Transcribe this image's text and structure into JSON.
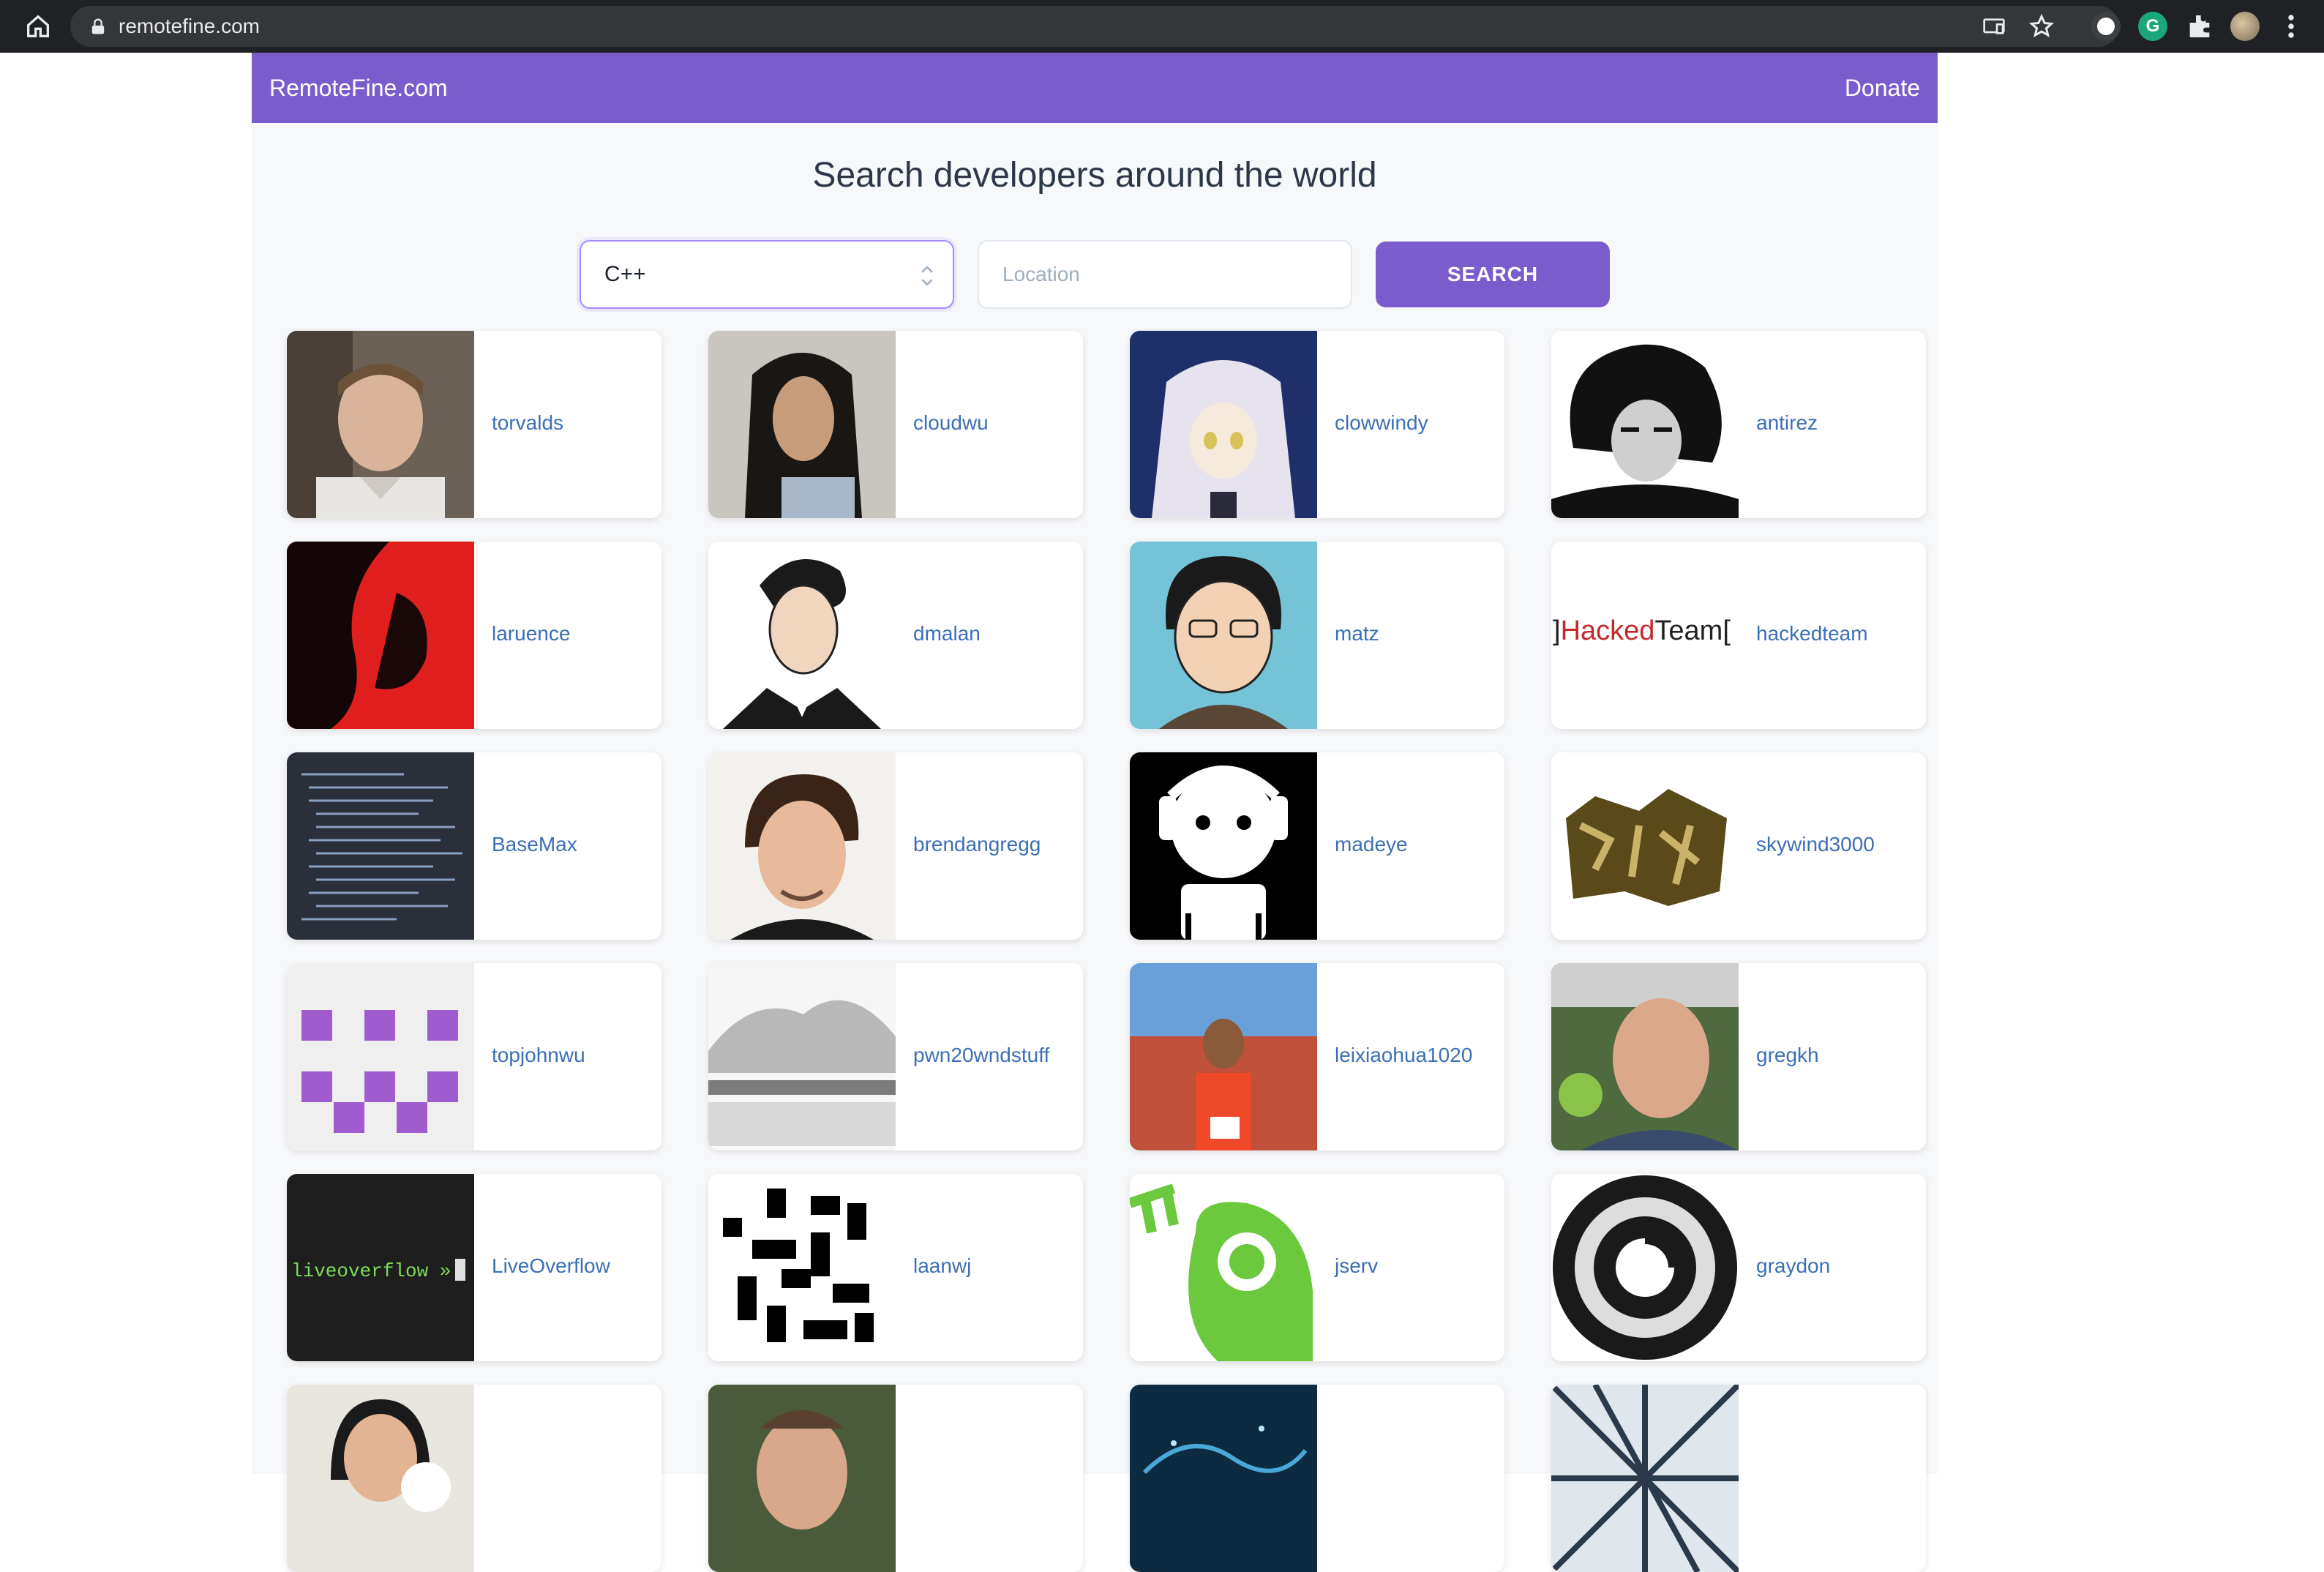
{
  "browser": {
    "url": "remotefine.com"
  },
  "navbar": {
    "brand": "RemoteFine.com",
    "donate": "Donate"
  },
  "headline": "Search developers around the world",
  "search": {
    "language": "C++",
    "location_placeholder": "Location",
    "button": "SEARCH"
  },
  "developers": [
    {
      "name": "torvalds"
    },
    {
      "name": "cloudwu"
    },
    {
      "name": "clowwindy"
    },
    {
      "name": "antirez"
    },
    {
      "name": "laruence"
    },
    {
      "name": "dmalan"
    },
    {
      "name": "matz"
    },
    {
      "name": "hackedteam",
      "avatar_text_1": "]Hacked",
      "avatar_text_2": "Team["
    },
    {
      "name": "BaseMax"
    },
    {
      "name": "brendangregg"
    },
    {
      "name": "madeye"
    },
    {
      "name": "skywind3000"
    },
    {
      "name": "topjohnwu"
    },
    {
      "name": "pwn20wndstuff"
    },
    {
      "name": "leixiaohua1020"
    },
    {
      "name": "gregkh"
    },
    {
      "name": "LiveOverflow",
      "avatar_text": "liveoverflow »"
    },
    {
      "name": "laanwj"
    },
    {
      "name": "jserv"
    },
    {
      "name": "graydon"
    },
    {
      "name": ""
    },
    {
      "name": ""
    },
    {
      "name": ""
    },
    {
      "name": ""
    }
  ]
}
